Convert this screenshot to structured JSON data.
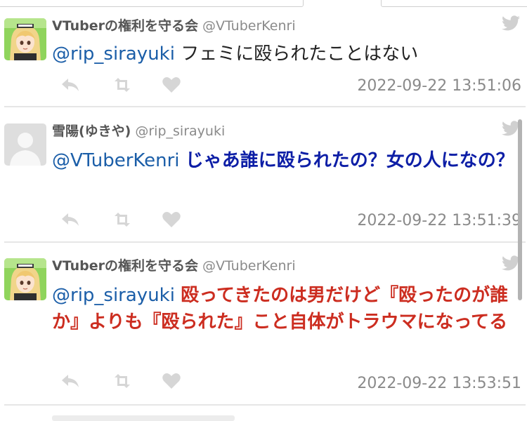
{
  "tweets": [
    {
      "display_name": "VTuberの権利を守る会",
      "handle": "@VTuberKenri",
      "mention": "@rip_sirayuki",
      "text": "フェミに殴られたことはない",
      "timestamp": "2022-09-22 13:51:06",
      "avatar": "anime-avatar"
    },
    {
      "display_name": "雪陽(ゆきや)",
      "handle": "@rip_sirayuki",
      "mention": "@VTuberKenri",
      "text": "じゃあ誰に殴られたの？女の人になの？",
      "timestamp": "2022-09-22 13:51:39",
      "avatar": "default-avatar"
    },
    {
      "display_name": "VTuberの権利を守る会",
      "handle": "@VTuberKenri",
      "mention": "@rip_sirayuki",
      "text": "殴ってきたのは男だけど『殴ったのが誰か』よりも『殴られた』こと自体がトラウマになってる",
      "timestamp": "2022-09-22 13:53:51",
      "avatar": "anime-avatar"
    }
  ],
  "colors": {
    "mention": "#1b5ea8",
    "blue_text": "#0d1ea6",
    "red_text": "#cc2d20",
    "muted": "#8a8a8a",
    "divider": "#e6e6e6"
  },
  "icons": {
    "reply": "reply-icon",
    "retweet": "retweet-icon",
    "like": "heart-icon",
    "brand": "twitter-bird-icon"
  }
}
